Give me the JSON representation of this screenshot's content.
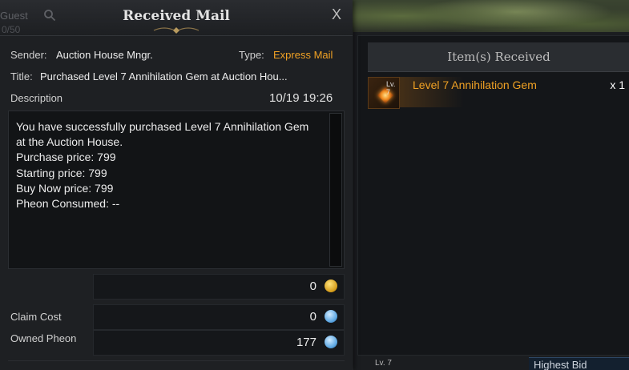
{
  "dialog": {
    "title": "Received Mail",
    "close_glyph": "X",
    "sender_label": "Sender:",
    "sender_value": "Auction House Mngr.",
    "type_label": "Type:",
    "type_value": "Express Mail",
    "title_label": "Title:",
    "title_value": "Purchased Level 7 Annihilation Gem at Auction Hou...",
    "description_label": "Description",
    "date": "10/19 19:26",
    "description": "You have successfully purchased Level 7 Annihilation Gem\nat the Auction House.\nPurchase price: 799\nStarting price: 799\nBuy Now price: 799\nPheon Consumed: --",
    "gold_amount": "0",
    "claim_cost_label": "Claim Cost",
    "claim_cost_value": "0",
    "owned_pheon_label": "Owned Pheon",
    "owned_pheon_value": "177"
  },
  "background": {
    "guest_label": "Guest",
    "guest_count": "0/50",
    "lv_badge": "Lv. 7",
    "highest_bid": "Highest Bid"
  },
  "items_panel": {
    "header": "Item(s) Received",
    "items": [
      {
        "level": "Lv. 7",
        "name": "Level 7 Annihilation Gem",
        "quantity": "x 1",
        "icon": "gem-icon"
      }
    ]
  },
  "colors": {
    "accent_orange": "#f0a124",
    "gold_coin": "#d39a18",
    "pheon_blue": "#5ba6e2"
  }
}
